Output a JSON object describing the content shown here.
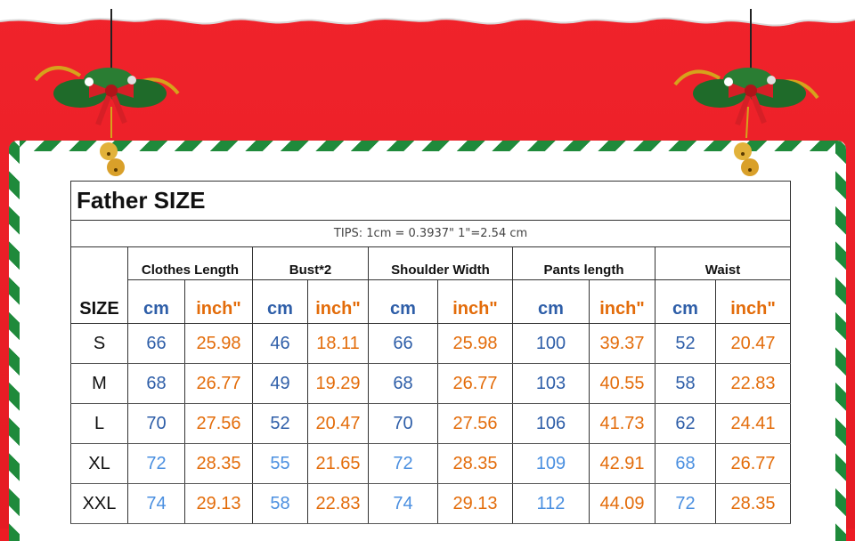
{
  "title": "Father  SIZE",
  "tips": "TIPS: 1cm = 0.3937\"   1\"=2.54 cm",
  "size_header": "SIZE",
  "groups": [
    {
      "label": "Clothes Length"
    },
    {
      "label": "Bust*2"
    },
    {
      "label": "Shoulder Width"
    },
    {
      "label": "Pants length"
    },
    {
      "label": "Waist"
    }
  ],
  "units": {
    "cm": "cm",
    "inch": "inch\""
  },
  "rows": [
    {
      "size": "S",
      "values": [
        "66",
        "25.98",
        "46",
        "18.11",
        "66",
        "25.98",
        "100",
        "39.37",
        "52",
        "20.47"
      ]
    },
    {
      "size": "M",
      "values": [
        "68",
        "26.77",
        "49",
        "19.29",
        "68",
        "26.77",
        "103",
        "40.55",
        "58",
        "22.83"
      ]
    },
    {
      "size": "L",
      "values": [
        "70",
        "27.56",
        "52",
        "20.47",
        "70",
        "27.56",
        "106",
        "41.73",
        "62",
        "24.41"
      ]
    },
    {
      "size": "XL",
      "values": [
        "72",
        "28.35",
        "55",
        "21.65",
        "72",
        "28.35",
        "109",
        "42.91",
        "68",
        "26.77"
      ]
    },
    {
      "size": "XXL",
      "values": [
        "74",
        "29.13",
        "58",
        "22.83",
        "74",
        "29.13",
        "112",
        "44.09",
        "72",
        "28.35"
      ]
    }
  ],
  "colors": {
    "background_red": "#ed1c24",
    "stripe_green": "#1f8a3b",
    "cm_blue": "#2e5ea8",
    "inch_orange": "#e36c0a"
  }
}
